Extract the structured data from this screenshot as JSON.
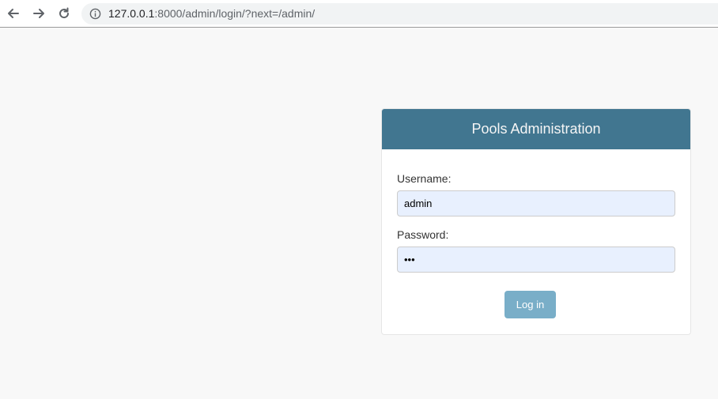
{
  "browser": {
    "url_host": "127.0.0.1",
    "url_rest": ":8000/admin/login/?next=/admin/",
    "back_icon": "arrow-left-icon",
    "forward_icon": "arrow-right-icon",
    "reload_icon": "reload-icon",
    "info_icon": "info-icon"
  },
  "login": {
    "title": "Pools Administration",
    "username_label": "Username:",
    "username_value": "admin",
    "password_label": "Password:",
    "password_value": "•••",
    "submit_label": "Log in",
    "header_color": "#417690",
    "button_color": "#79aec8"
  }
}
